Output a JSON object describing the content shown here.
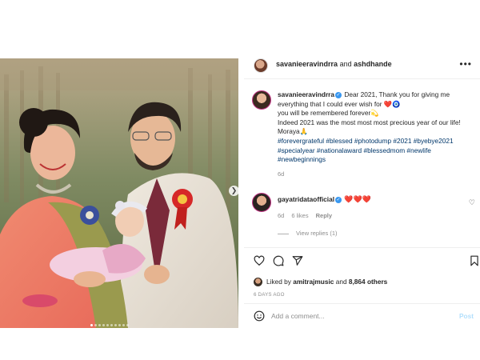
{
  "header": {
    "username": "savanieeravindrra",
    "and_text": " and ",
    "collaborator": "ashdhande",
    "more_icon": "more-horizontal-icon"
  },
  "caption": {
    "username": "savanieeravindrra",
    "line1": " Dear 2021, Thank you for giving me everything that I could ever wish for ❤️🧿",
    "line2": "you will be remembered forever💫",
    "line3": "Indeed 2021 was the most most most precious year of our life!",
    "line4": "Moraya🙏",
    "hashtags": "#forevergrateful #blessed #photodump #2021 #byebye2021 #specialyear #nationalaward #blessedmom #newlife #newbeginnings",
    "time": "6d"
  },
  "comment": {
    "username": "gayatridataofficial",
    "hearts": "❤️❤️❤️",
    "time": "6d",
    "likes": "6 likes",
    "reply": "Reply",
    "view_replies": "View replies (1)"
  },
  "actions": {
    "icons": [
      "heart-icon",
      "comment-icon",
      "share-icon",
      "bookmark-icon"
    ]
  },
  "likes": {
    "prefix": "Liked by ",
    "user": "amitrajmusic",
    "middle": " and ",
    "others": "8,864 others"
  },
  "date": "6 DAYS AGO",
  "add_comment": {
    "placeholder": "Add a comment...",
    "post_label": "Post"
  },
  "carousel": {
    "slide_count": 10,
    "active_index": 0
  },
  "colors": {
    "link_blue": "#00376b",
    "verified_blue": "#3897f0",
    "heart_red": "#ed4956",
    "post_disabled": "#b2dffc",
    "muted": "#8e8e8e"
  }
}
